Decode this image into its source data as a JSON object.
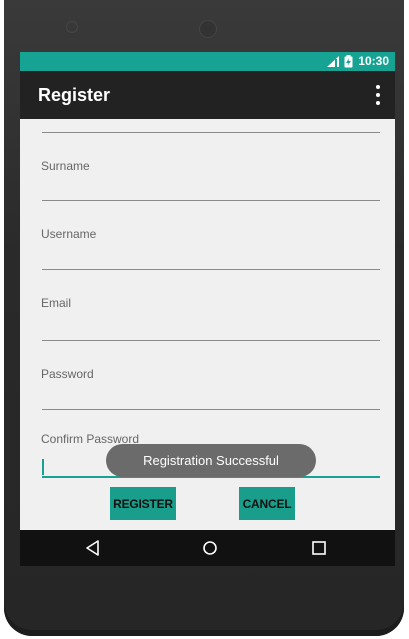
{
  "status_bar": {
    "time": "10:30"
  },
  "app_bar": {
    "title": "Register",
    "menu_icon": "overflow-menu-icon"
  },
  "form": {
    "fields": [
      {
        "label": "Surname",
        "value": ""
      },
      {
        "label": "Username",
        "value": ""
      },
      {
        "label": "Email",
        "value": ""
      },
      {
        "label": "Password",
        "value": ""
      },
      {
        "label": "Confirm Password",
        "value": ""
      }
    ]
  },
  "buttons": {
    "register_label": "REGISTER",
    "cancel_label": "CANCEL"
  },
  "toast": {
    "message": "Registration Successful"
  },
  "nav": {
    "back_icon": "back-icon",
    "home_icon": "home-icon",
    "recents_icon": "recents-icon"
  },
  "colors": {
    "accent": "#16a394",
    "app_bar": "#222222",
    "background": "#f0f0f0"
  }
}
